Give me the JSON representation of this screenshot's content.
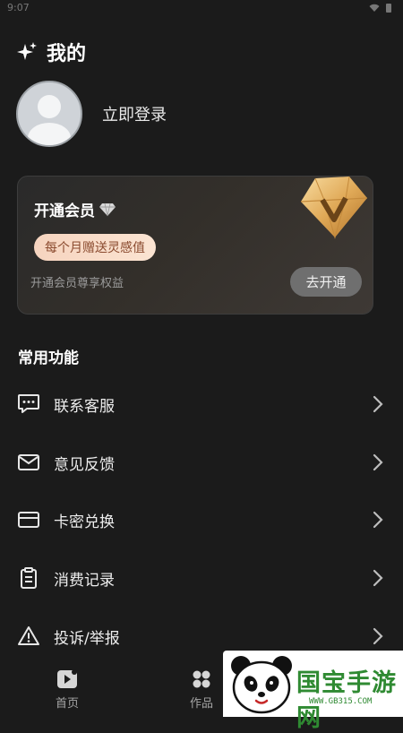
{
  "status_bar": {
    "time": "9:07"
  },
  "header": {
    "title": "我的",
    "icon": "sparkle-icon"
  },
  "profile": {
    "login_label": "立即登录"
  },
  "vip_card": {
    "title": "开通会员",
    "badge": "每个月赠送灵感值",
    "description": "开通会员尊享权益",
    "button": "去开通"
  },
  "section": {
    "title": "常用功能"
  },
  "menu": [
    {
      "label": "联系客服",
      "icon": "chat-icon"
    },
    {
      "label": "意见反馈",
      "icon": "mail-icon"
    },
    {
      "label": "卡密兑换",
      "icon": "card-icon"
    },
    {
      "label": "消费记录",
      "icon": "clipboard-icon"
    },
    {
      "label": "投诉/举报",
      "icon": "warning-icon"
    }
  ],
  "tabs": [
    {
      "label": "首页",
      "icon": "play-icon"
    },
    {
      "label": "作品",
      "icon": "grid-icon"
    }
  ],
  "watermark": {
    "brand": "国宝手游网",
    "url": "WWW.GB315.COM"
  },
  "colors": {
    "background": "#1b1b1b",
    "badge_text": "#8a4a2e",
    "watermark_green": "#2f8a32"
  }
}
